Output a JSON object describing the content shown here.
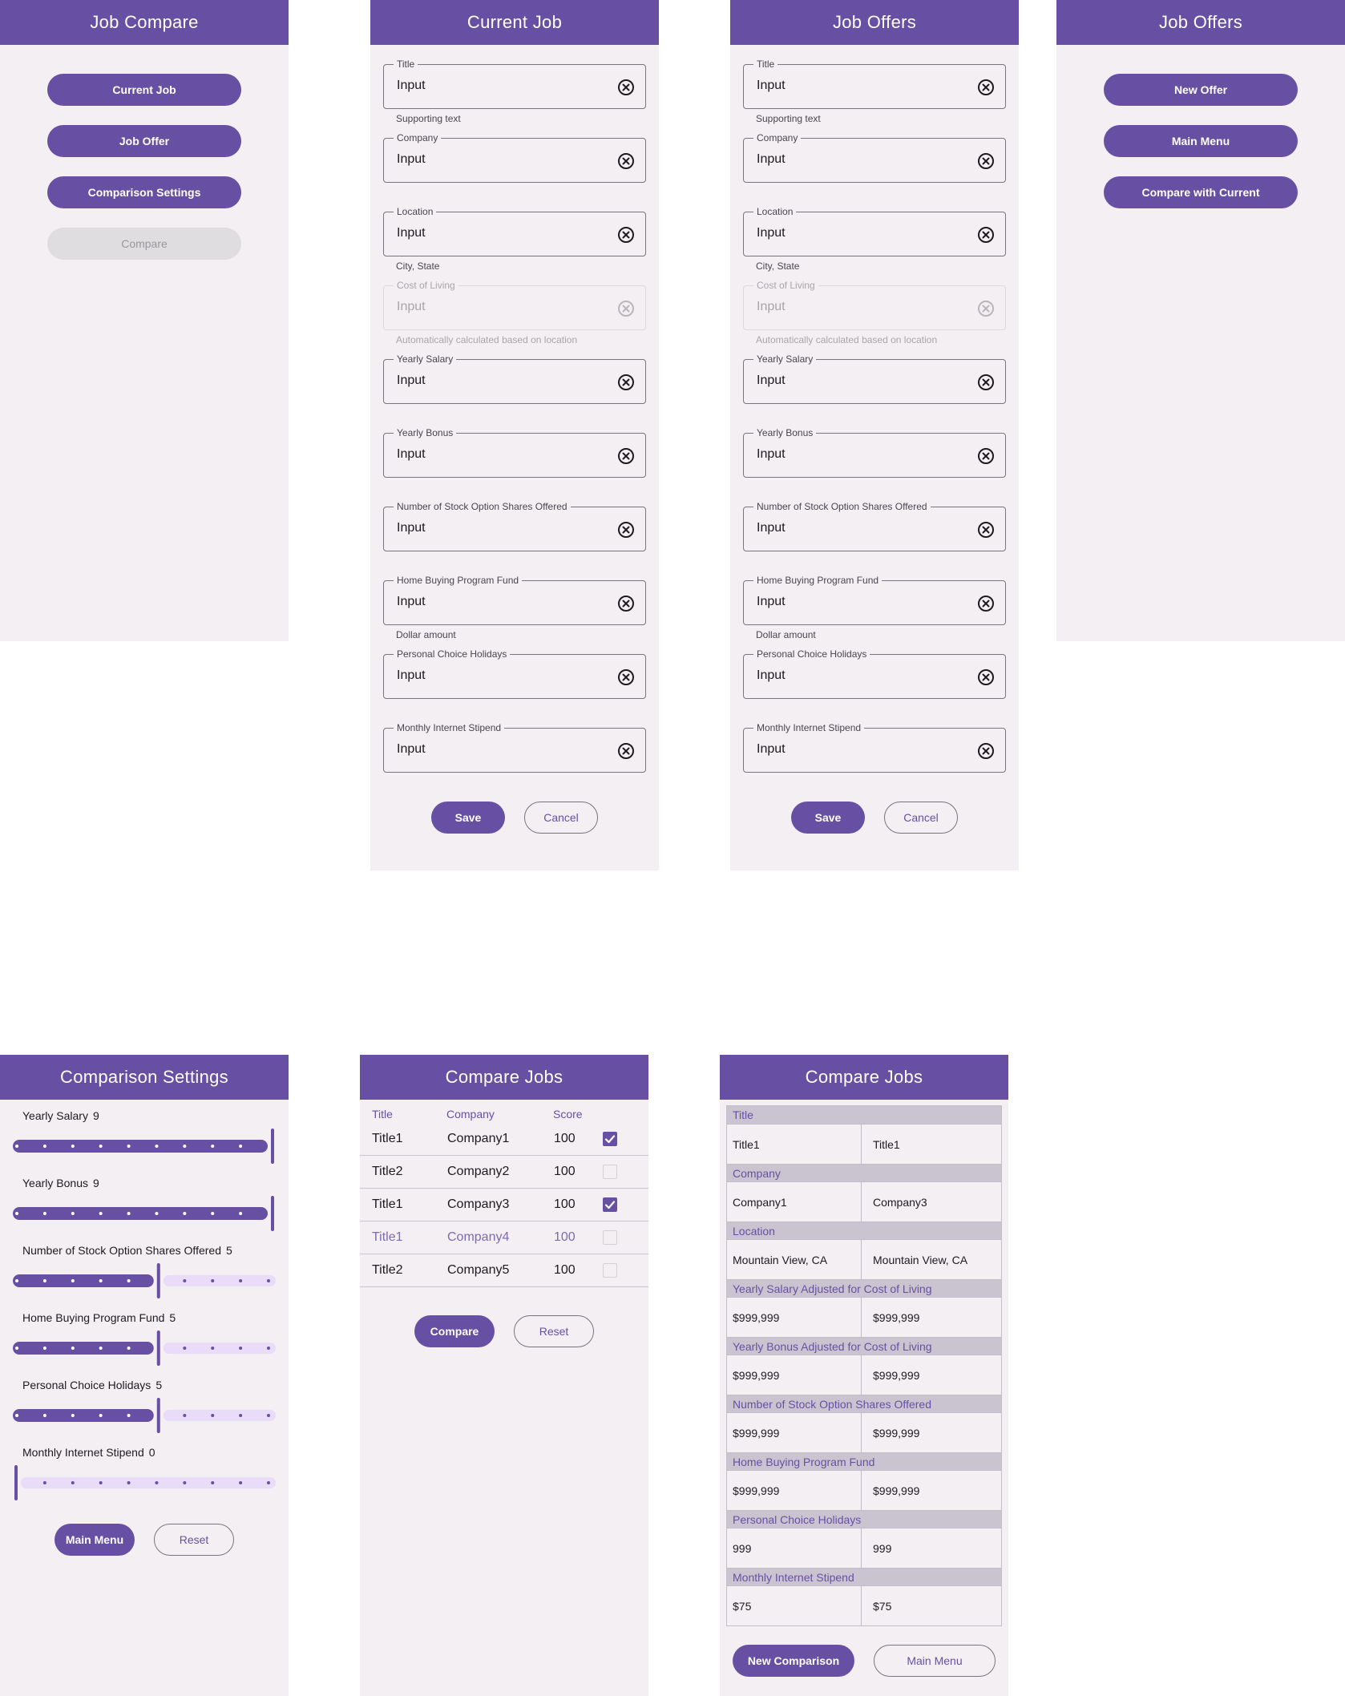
{
  "colors": {
    "primary": "#6750a4",
    "surface": "#f3eff3",
    "track_inactive": "#e8dcf8"
  },
  "icons": {
    "clear": "circle-x-icon",
    "check": "checkbox-checked-icon"
  },
  "job_compare": {
    "title": "Job Compare",
    "buttons": [
      "Current Job",
      "Job Offer",
      "Comparison Settings",
      "Compare"
    ],
    "compare_disabled": true
  },
  "current_job": {
    "title": "Current Job",
    "fields": [
      {
        "label": "Title",
        "value": "Input",
        "support": "Supporting text",
        "disabled": false
      },
      {
        "label": "Company",
        "value": "Input",
        "support": "",
        "disabled": false
      },
      {
        "label": "Location",
        "value": "Input",
        "support": "City, State",
        "disabled": false
      },
      {
        "label": "Cost of Living",
        "value": "Input",
        "support": "Automatically calculated based on location",
        "disabled": true
      },
      {
        "label": "Yearly Salary",
        "value": "Input",
        "support": "",
        "disabled": false
      },
      {
        "label": "Yearly Bonus",
        "value": "Input",
        "support": "",
        "disabled": false
      },
      {
        "label": "Number of Stock Option Shares Offered",
        "value": "Input",
        "support": "",
        "disabled": false
      },
      {
        "label": "Home Buying Program Fund",
        "value": "Input",
        "support": "Dollar amount",
        "disabled": false
      },
      {
        "label": "Personal Choice Holidays",
        "value": "Input",
        "support": "",
        "disabled": false
      },
      {
        "label": "Monthly Internet Stipend",
        "value": "Input",
        "support": "",
        "disabled": false
      }
    ],
    "save_label": "Save",
    "cancel_label": "Cancel"
  },
  "job_offer_form": {
    "title": "Job Offers",
    "fields": [
      {
        "label": "Title",
        "value": "Input",
        "support": "Supporting text",
        "disabled": false
      },
      {
        "label": "Company",
        "value": "Input",
        "support": "",
        "disabled": false
      },
      {
        "label": "Location",
        "value": "Input",
        "support": "City, State",
        "disabled": false
      },
      {
        "label": "Cost of Living",
        "value": "Input",
        "support": "Automatically calculated based on location",
        "disabled": true
      },
      {
        "label": "Yearly Salary",
        "value": "Input",
        "support": "",
        "disabled": false
      },
      {
        "label": "Yearly Bonus",
        "value": "Input",
        "support": "",
        "disabled": false
      },
      {
        "label": "Number of Stock Option Shares Offered",
        "value": "Input",
        "support": "",
        "disabled": false
      },
      {
        "label": "Home Buying Program Fund",
        "value": "Input",
        "support": "Dollar amount",
        "disabled": false
      },
      {
        "label": "Personal Choice Holidays",
        "value": "Input",
        "support": "",
        "disabled": false
      },
      {
        "label": "Monthly Internet Stipend",
        "value": "Input",
        "support": "",
        "disabled": false
      }
    ],
    "save_label": "Save",
    "cancel_label": "Cancel"
  },
  "job_offers_menu": {
    "title": "Job Offers",
    "buttons": [
      "New Offer",
      "Main Menu",
      "Compare with Current"
    ]
  },
  "comparison_settings": {
    "title": "Comparison Settings",
    "max_weight": 9,
    "sliders": [
      {
        "label": "Yearly Salary",
        "value": 9
      },
      {
        "label": "Yearly Bonus",
        "value": 9
      },
      {
        "label": "Number of Stock Option Shares Offered",
        "value": 5
      },
      {
        "label": "Home Buying Program Fund",
        "value": 5
      },
      {
        "label": "Personal Choice Holidays",
        "value": 5
      },
      {
        "label": "Monthly Internet Stipend",
        "value": 0
      }
    ],
    "main_menu_label": "Main Menu",
    "reset_label": "Reset"
  },
  "compare_jobs_list": {
    "title": "Compare Jobs",
    "headers": [
      "Title",
      "Company",
      "Score"
    ],
    "rows": [
      {
        "title": "Title1",
        "company": "Company1",
        "score": "100",
        "checked": true,
        "faded": false
      },
      {
        "title": "Title2",
        "company": "Company2",
        "score": "100",
        "checked": false,
        "faded": false
      },
      {
        "title": "Title1",
        "company": "Company3",
        "score": "100",
        "checked": true,
        "faded": false
      },
      {
        "title": "Title1",
        "company": "Company4",
        "score": "100",
        "checked": false,
        "faded": true
      },
      {
        "title": "Title2",
        "company": "Company5",
        "score": "100",
        "checked": false,
        "faded": false
      }
    ],
    "compare_label": "Compare",
    "reset_label": "Reset"
  },
  "compare_jobs_table": {
    "title": "Compare Jobs",
    "sections": [
      {
        "header": "Title",
        "values": [
          "Title1",
          "Title1"
        ]
      },
      {
        "header": "Company",
        "values": [
          "Company1",
          "Company3"
        ]
      },
      {
        "header": "Location",
        "values": [
          "Mountain View, CA",
          "Mountain View, CA"
        ]
      },
      {
        "header": "Yearly Salary Adjusted for Cost of Living",
        "values": [
          "$999,999",
          "$999,999"
        ]
      },
      {
        "header": "Yearly Bonus Adjusted for Cost of Living",
        "values": [
          "$999,999",
          "$999,999"
        ]
      },
      {
        "header": "Number of Stock Option Shares Offered",
        "values": [
          "$999,999",
          "$999,999"
        ]
      },
      {
        "header": "Home Buying Program Fund",
        "values": [
          "$999,999",
          "$999,999"
        ]
      },
      {
        "header": "Personal Choice Holidays",
        "values": [
          "999",
          "999"
        ]
      },
      {
        "header": "Monthly Internet Stipend",
        "values": [
          "$75",
          "$75"
        ]
      }
    ],
    "new_comparison_label": "New Comparison",
    "main_menu_label": "Main Menu"
  }
}
